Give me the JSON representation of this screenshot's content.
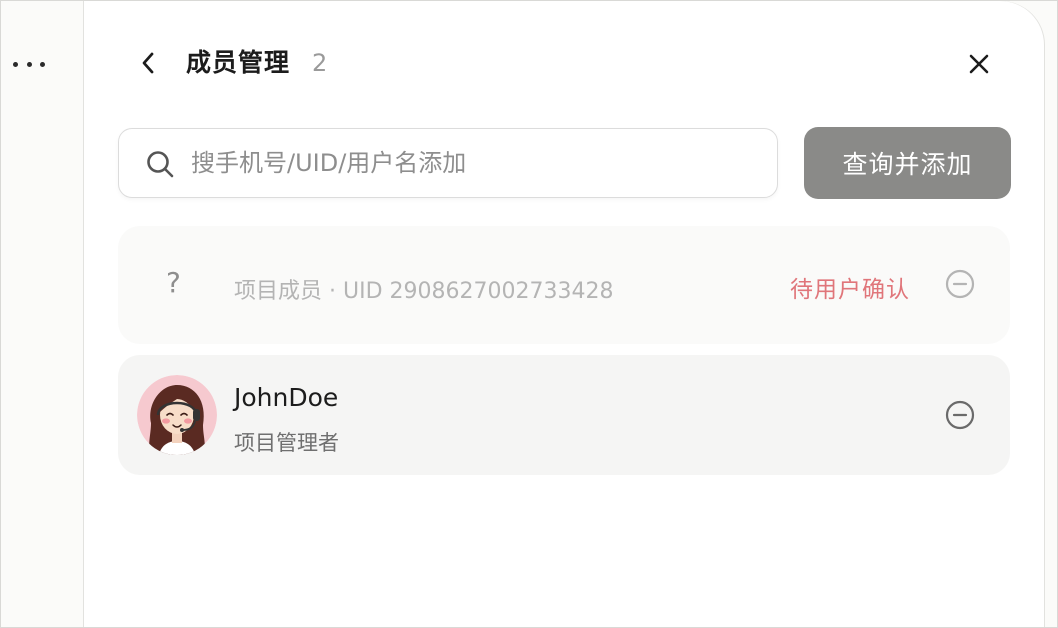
{
  "header": {
    "title": "成员管理",
    "count": "2"
  },
  "search": {
    "placeholder": "搜手机号/UID/用户名添加",
    "value": "",
    "button_label": "查询并添加"
  },
  "members": [
    {
      "avatar_text": "?",
      "description": "项目成员 · UID 2908627002733428",
      "status": "待用户确认",
      "status_color": "#e0757a"
    },
    {
      "avatar": "cartoon-woman-headset-avatar",
      "name": "JohnDoe",
      "role": "项目管理者"
    }
  ],
  "colors": {
    "accent_button": "#8a8a88",
    "pending_status": "#e0757a",
    "avatar_bg": "#f6c9cf"
  }
}
